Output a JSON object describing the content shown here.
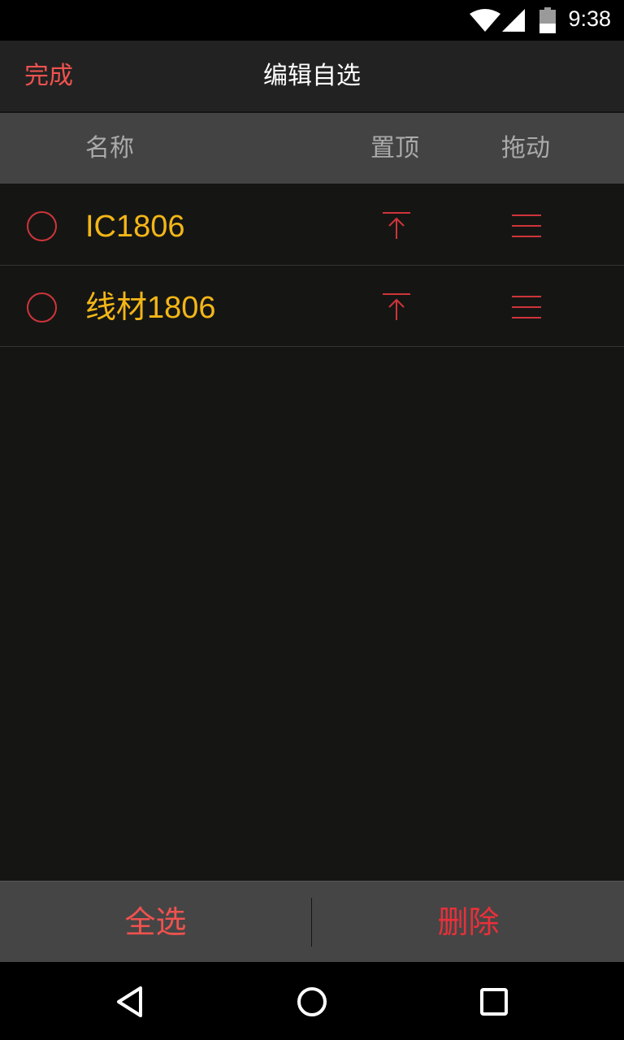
{
  "status_bar": {
    "time": "9:38"
  },
  "header": {
    "done_label": "完成",
    "title": "编辑自选"
  },
  "columns": {
    "name": "名称",
    "pin_top": "置顶",
    "drag": "拖动"
  },
  "items": [
    {
      "name": "IC1806"
    },
    {
      "name": "线材1806"
    }
  ],
  "footer": {
    "select_all_label": "全选",
    "delete_label": "删除"
  },
  "colors": {
    "accent_red": "#e8303a",
    "item_gold": "#f4b617",
    "background": "#151614",
    "header_grey": "#434343"
  },
  "icons": {
    "wifi": "wifi-icon",
    "signal": "cell-signal-icon",
    "battery": "battery-icon",
    "pin": "pin-to-top-icon",
    "drag": "drag-handle-icon",
    "back": "back-triangle-icon",
    "home": "home-circle-icon",
    "recents": "recents-square-icon"
  }
}
